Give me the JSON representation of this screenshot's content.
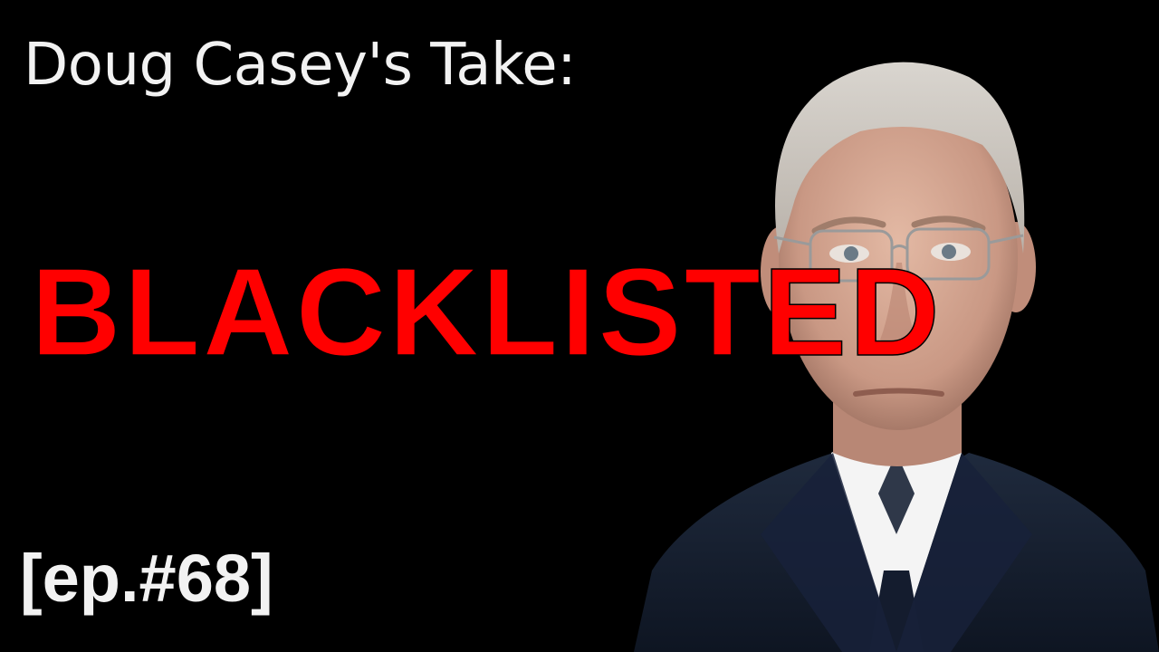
{
  "thumbnail": {
    "title": "Doug Casey's Take:",
    "headline": "BLACKLISTED",
    "episode": "[ep.#68]"
  },
  "colors": {
    "background": "#000000",
    "title_text": "#f2f2f2",
    "headline_text": "#ff0000"
  }
}
